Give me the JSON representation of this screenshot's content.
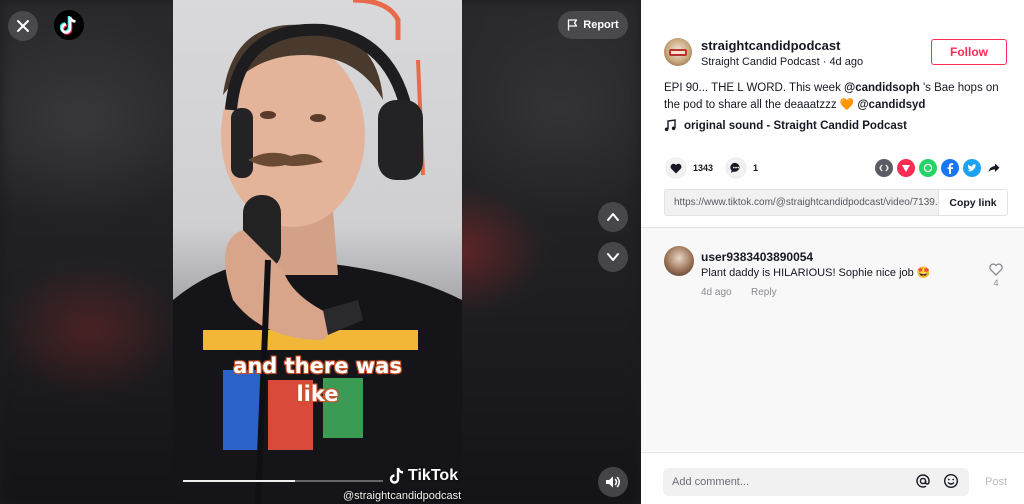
{
  "player": {
    "report_label": "Report",
    "caption_line1": "and there was",
    "caption_line2": "like",
    "watermark_brand": "TikTok",
    "watermark_handle": "@straightcandidpodcast",
    "progress": 0.56
  },
  "author": {
    "username": "straightcandidpodcast",
    "display_name": "Straight Candid Podcast",
    "age": "4d ago",
    "follow_label": "Follow"
  },
  "post": {
    "description_pre": "EPI 90... THE L WORD. This week ",
    "mention1": "@candidsoph",
    "description_mid": " 's Bae hops on the pod to share all the deaaatzzz 🧡 ",
    "mention2": "@candidsyd",
    "sound": "original sound - Straight Candid Podcast",
    "likes": "1343",
    "comments": "1",
    "link": "https://www.tiktok.com/@straightcandidpodcast/video/7139...",
    "copy_link_label": "Copy link"
  },
  "share_icons": [
    "embed-icon",
    "friends-icon",
    "whatsapp-icon",
    "facebook-icon",
    "twitter-icon",
    "share-arrow-icon"
  ],
  "comment": {
    "username": "user9383403890054",
    "text": "Plant daddy is HILARIOUS! Sophie nice job 🤩",
    "date": "4d ago",
    "reply_label": "Reply",
    "likes": "4"
  },
  "composer": {
    "placeholder": "Add comment...",
    "post_label": "Post"
  },
  "colors": {
    "accent": "#fe2c55",
    "text": "#161823",
    "muted": "#8a8b91"
  }
}
